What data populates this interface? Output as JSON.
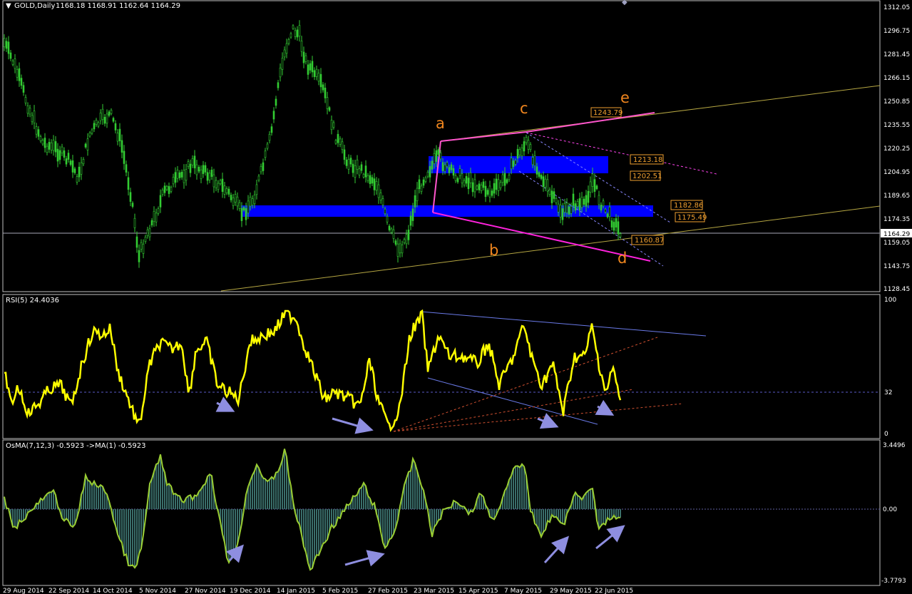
{
  "main": {
    "title": "GOLD,Daily",
    "ohlc": "1168.18 1168.91 1162.64 1164.29",
    "price_axis": [
      "1312.05",
      "1296.75",
      "1281.45",
      "1266.15",
      "1250.85",
      "1235.55",
      "1220.25",
      "1204.95",
      "1189.65",
      "1174.35",
      "1159.05",
      "1143.75",
      "1128.45"
    ],
    "current_price": "1164.29",
    "waves": [
      "a",
      "b",
      "c",
      "d",
      "e"
    ],
    "price_tags": [
      "1243.79",
      "1213.18",
      "1202.51",
      "1182.86",
      "1175.49",
      "1160.87"
    ]
  },
  "rsi": {
    "title": "RSI(5) 24.4036",
    "levels": [
      "100",
      "32",
      "0"
    ]
  },
  "osma": {
    "title": "OsMA(7,12,3) -0.5923  ->MA(1) -0.5923",
    "levels": [
      "3.4496",
      "0.00",
      "-3.7793"
    ]
  },
  "dates": [
    "29 Aug 2014",
    "22 Sep 2014",
    "14 Oct 2014",
    "5 Nov 2014",
    "27 Nov 2014",
    "19 Dec 2014",
    "14 Jan 2015",
    "5 Feb 2015",
    "27 Feb 2015",
    "23 Mar 2015",
    "15 Apr 2015",
    "7 May 2015",
    "29 May 2015",
    "22 Jun 2015"
  ],
  "colors": {
    "candles": "#33cc33",
    "rsi_line": "#ffff00",
    "osma_line": "#9acd32",
    "osma_bars": "#3a6e6a",
    "zones": "#0000ff",
    "channel": "#ff44cc",
    "trend": "#b5a642",
    "arrows": "#8e8ee0",
    "wave_labels": "#f0861e"
  }
}
